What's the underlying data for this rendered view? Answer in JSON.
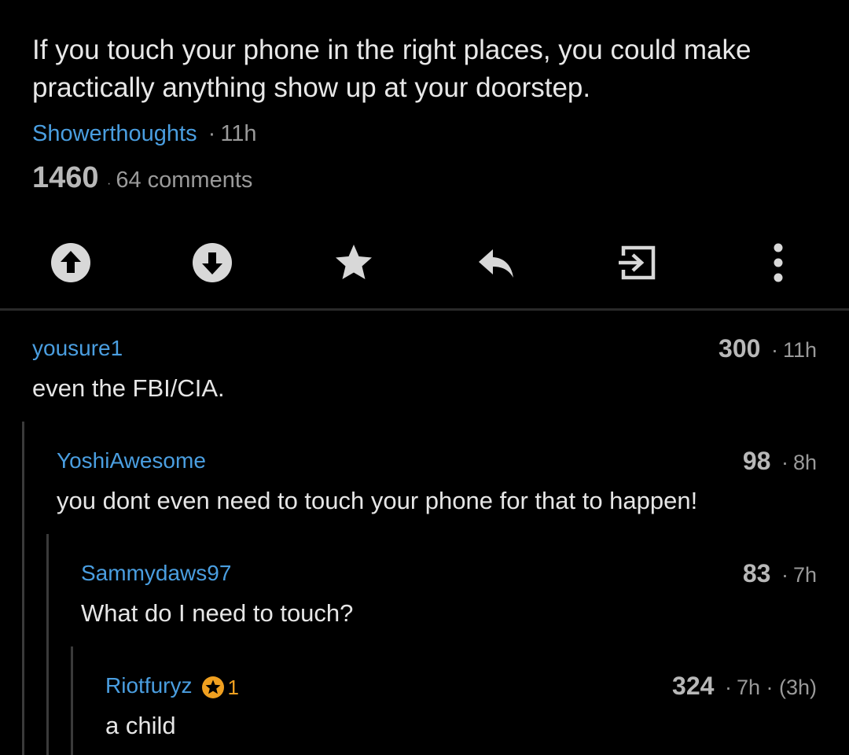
{
  "post": {
    "title": "If you touch your phone in the right places, you could make practically anything show up at your doorstep.",
    "subreddit": "Showerthoughts",
    "sep": "·",
    "age": "11h",
    "score": "1460",
    "comments": "64 comments"
  },
  "actions": [
    {
      "name": "upvote-icon"
    },
    {
      "name": "downvote-icon"
    },
    {
      "name": "save-star-icon"
    },
    {
      "name": "reply-icon"
    },
    {
      "name": "open-link-icon"
    },
    {
      "name": "more-options-icon"
    }
  ],
  "colors": {
    "background": "#000000",
    "link": "#4a9ee0",
    "gold": "#f0a020"
  },
  "comments": [
    {
      "author": "yousure1",
      "score": "300",
      "meta": "11h",
      "body": "even the FBI/CIA."
    },
    {
      "author": "YoshiAwesome",
      "score": "98",
      "meta": "8h",
      "body": "you dont even need to touch your phone for that to happen!"
    },
    {
      "author": "Sammydaws97",
      "score": "83",
      "meta": "7h",
      "body": "What do I need to touch?"
    },
    {
      "author": "Riotfuryz",
      "score": "324",
      "meta": "7h · (3h)",
      "body": "a child",
      "gold_count": "1"
    }
  ]
}
